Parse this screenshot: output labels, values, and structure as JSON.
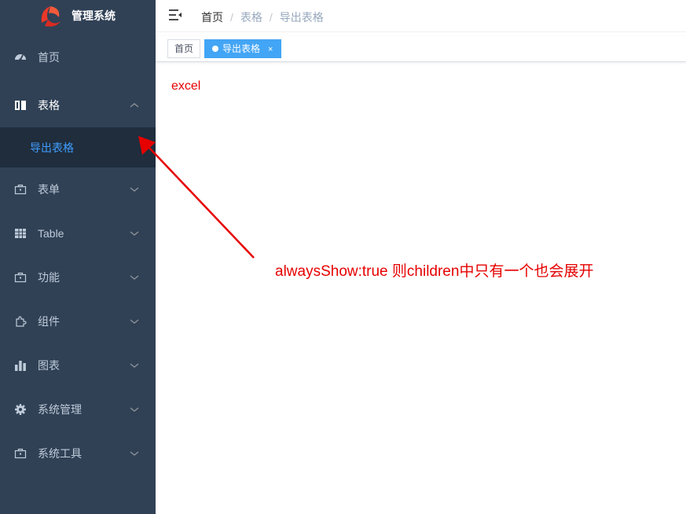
{
  "app": {
    "title": "管理系统"
  },
  "sidebar": {
    "items": [
      {
        "label": "首页",
        "icon": "dashboard-icon"
      },
      {
        "label": "表格",
        "icon": "book-icon",
        "expanded": true,
        "children": [
          {
            "label": "导出表格",
            "active": true
          }
        ]
      },
      {
        "label": "表单",
        "icon": "toolbox-icon"
      },
      {
        "label": "Table",
        "icon": "table-grid-icon"
      },
      {
        "label": "功能",
        "icon": "toolbox-icon"
      },
      {
        "label": "组件",
        "icon": "puzzle-icon"
      },
      {
        "label": "图表",
        "icon": "bar-chart-icon"
      },
      {
        "label": "系统管理",
        "icon": "gear-icon"
      },
      {
        "label": "系统工具",
        "icon": "toolbox-icon"
      }
    ]
  },
  "breadcrumb": {
    "home": "首页",
    "level1": "表格",
    "level2": "导出表格",
    "separator": "/"
  },
  "tags": {
    "home": "首页",
    "active": "导出表格",
    "close": "×"
  },
  "content": {
    "text": "excel"
  },
  "annotation": {
    "text": "alwaysShow:true 则children中只有一个也会展开"
  },
  "colors": {
    "sidebar_bg": "#304156",
    "submenu_bg": "#1f2d3d",
    "active_link": "#409eff",
    "active_tag": "#42a5f5",
    "annotation": "#e60000"
  }
}
